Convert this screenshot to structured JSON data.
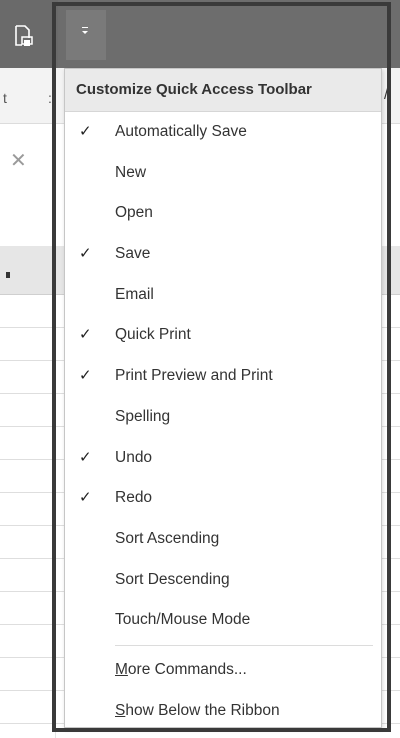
{
  "menu": {
    "title": "Customize Quick Access Toolbar",
    "items": [
      {
        "label": "Automatically Save",
        "checked": true
      },
      {
        "label": "New",
        "checked": false
      },
      {
        "label": "Open",
        "checked": false
      },
      {
        "label": "Save",
        "checked": true
      },
      {
        "label": "Email",
        "checked": false
      },
      {
        "label": "Quick Print",
        "checked": true
      },
      {
        "label": "Print Preview and Print",
        "checked": true
      },
      {
        "label": "Spelling",
        "checked": false
      },
      {
        "label": "Undo",
        "checked": true
      },
      {
        "label": "Redo",
        "checked": true
      },
      {
        "label": "Sort Ascending",
        "checked": false
      },
      {
        "label": "Sort Descending",
        "checked": false
      },
      {
        "label": "Touch/Mouse Mode",
        "checked": false
      }
    ],
    "more_commands": {
      "accel": "M",
      "rest": "ore Commands..."
    },
    "show_below": {
      "accel": "S",
      "rest": "how Below the Ribbon"
    },
    "check_glyph": "✓"
  },
  "background": {
    "ribbon_fragment_left": "t",
    "ribbon_fragment_right": "/",
    "close_glyph": "✕"
  },
  "icons": {
    "qat_dropdown": "chevron-down-icon",
    "print_preview": "print-preview-icon"
  },
  "colors": {
    "titlebar": "#6d6d6d",
    "menu_header": "#eaeaea",
    "frame": "#3a3a3a"
  }
}
